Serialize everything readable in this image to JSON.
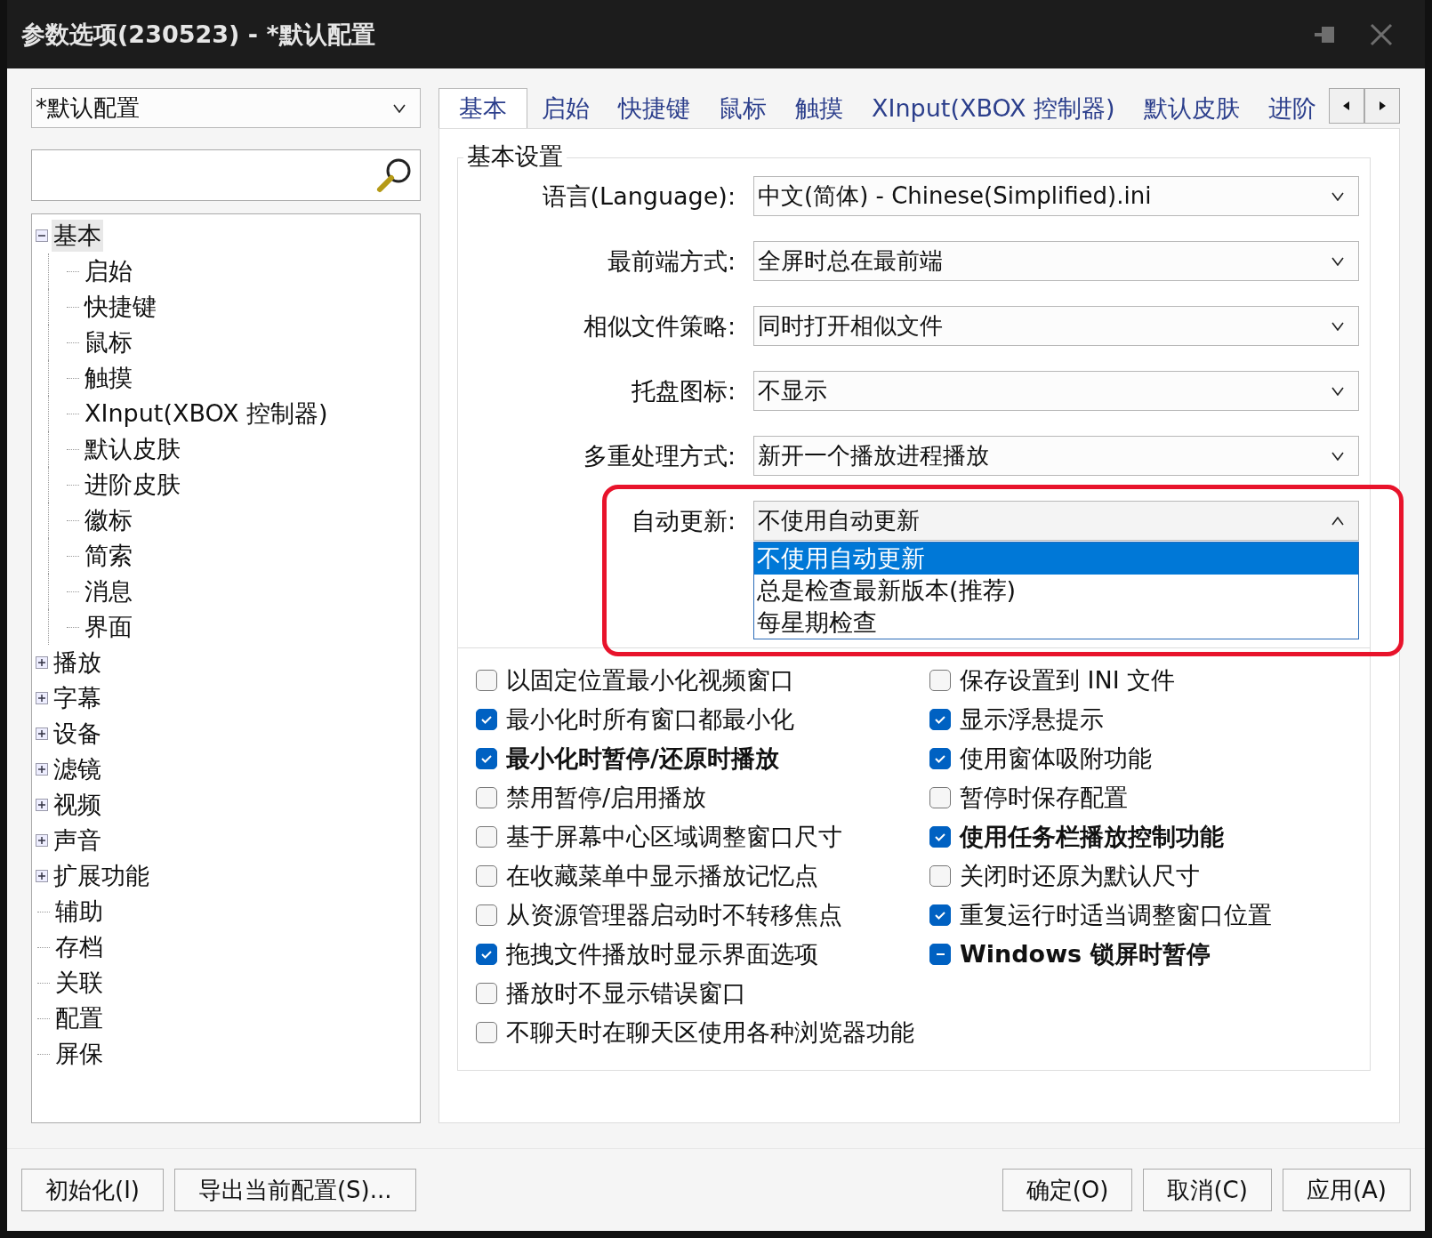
{
  "window": {
    "title": "参数选项(230523) - *默认配置"
  },
  "profile_select": {
    "value": "*默认配置"
  },
  "tree": [
    {
      "label": "基本",
      "expanded": true,
      "selected": true,
      "children": [
        {
          "label": "启始",
          "selected": false
        },
        {
          "label": "快捷键",
          "selected": false
        },
        {
          "label": "鼠标",
          "selected": false
        },
        {
          "label": "触摸",
          "selected": false
        },
        {
          "label": "XInput(XBOX 控制器)",
          "selected": false
        },
        {
          "label": "默认皮肤",
          "selected": false
        },
        {
          "label": "进阶皮肤",
          "selected": false
        },
        {
          "label": "徽标",
          "selected": false
        },
        {
          "label": "简索",
          "selected": false
        },
        {
          "label": "消息",
          "selected": false
        },
        {
          "label": "界面",
          "selected": false
        }
      ]
    },
    {
      "label": "播放",
      "expanded": false,
      "selected": false
    },
    {
      "label": "字幕",
      "expanded": false,
      "selected": false
    },
    {
      "label": "设备",
      "expanded": false,
      "selected": false
    },
    {
      "label": "滤镜",
      "expanded": false,
      "selected": false
    },
    {
      "label": "视频",
      "expanded": false,
      "selected": false
    },
    {
      "label": "声音",
      "expanded": false,
      "selected": false
    },
    {
      "label": "扩展功能",
      "expanded": false,
      "selected": false
    },
    {
      "label": "辅助",
      "selected": false
    },
    {
      "label": "存档",
      "selected": false
    },
    {
      "label": "关联",
      "selected": false
    },
    {
      "label": "配置",
      "selected": false
    },
    {
      "label": "屏保",
      "selected": false
    }
  ],
  "tabs": [
    {
      "label": "基本",
      "selected": true
    },
    {
      "label": "启始",
      "selected": false
    },
    {
      "label": "快捷键",
      "selected": false
    },
    {
      "label": "鼠标",
      "selected": false
    },
    {
      "label": "触摸",
      "selected": false
    },
    {
      "label": "XInput(XBOX 控制器)",
      "selected": false
    },
    {
      "label": "默认皮肤",
      "selected": false
    },
    {
      "label": "进阶",
      "selected": false
    }
  ],
  "settings": {
    "title": "基本设置",
    "rows": [
      {
        "label": "语言(Language):",
        "value": "中文(简体) - Chinese(Simplified).ini",
        "expanded": false,
        "highlighted": false
      },
      {
        "label": "最前端方式:",
        "value": "全屏时总在最前端",
        "expanded": false,
        "highlighted": false
      },
      {
        "label": "相似文件策略:",
        "value": "同时打开相似文件",
        "expanded": false,
        "highlighted": false
      },
      {
        "label": "托盘图标:",
        "value": "不显示",
        "expanded": false,
        "highlighted": false
      },
      {
        "label": "多重处理方式:",
        "value": "新开一个播放进程播放",
        "expanded": false,
        "highlighted": false
      },
      {
        "label": "自动更新:",
        "value": "不使用自动更新",
        "expanded": true,
        "highlighted": true,
        "options": [
          {
            "label": "不使用自动更新",
            "selected": true
          },
          {
            "label": "总是检查最新版本(推荐)",
            "selected": false
          },
          {
            "label": "每星期检查",
            "selected": false
          }
        ]
      }
    ],
    "left_checks": [
      {
        "label": "以固定位置最小化视频窗口",
        "checked": false,
        "indeterminate": false,
        "bold": false
      },
      {
        "label": "最小化时所有窗口都最小化",
        "checked": true,
        "indeterminate": false,
        "bold": false
      },
      {
        "label": "最小化时暂停/还原时播放",
        "checked": true,
        "indeterminate": false,
        "bold": true
      },
      {
        "label": "禁用暂停/启用播放",
        "checked": false,
        "indeterminate": false,
        "bold": false
      },
      {
        "label": "基于屏幕中心区域调整窗口尺寸",
        "checked": false,
        "indeterminate": false,
        "bold": false
      },
      {
        "label": "在收藏菜单中显示播放记忆点",
        "checked": false,
        "indeterminate": false,
        "bold": false
      },
      {
        "label": "从资源管理器启动时不转移焦点",
        "checked": false,
        "indeterminate": false,
        "bold": false
      },
      {
        "label": "拖拽文件播放时显示界面选项",
        "checked": true,
        "indeterminate": false,
        "bold": false
      },
      {
        "label": "播放时不显示错误窗口",
        "checked": false,
        "indeterminate": false,
        "bold": false
      },
      {
        "label": "不聊天时在聊天区使用各种浏览器功能",
        "checked": false,
        "indeterminate": false,
        "bold": false
      }
    ],
    "right_checks": [
      {
        "label": "保存设置到 INI 文件",
        "checked": false,
        "indeterminate": false,
        "bold": false
      },
      {
        "label": "显示浮悬提示",
        "checked": true,
        "indeterminate": false,
        "bold": false
      },
      {
        "label": "使用窗体吸附功能",
        "checked": true,
        "indeterminate": false,
        "bold": false
      },
      {
        "label": "暂停时保存配置",
        "checked": false,
        "indeterminate": false,
        "bold": false
      },
      {
        "label": "使用任务栏播放控制功能",
        "checked": true,
        "indeterminate": false,
        "bold": true
      },
      {
        "label": "关闭时还原为默认尺寸",
        "checked": false,
        "indeterminate": false,
        "bold": false
      },
      {
        "label": "重复运行时适当调整窗口位置",
        "checked": true,
        "indeterminate": false,
        "bold": false
      },
      {
        "label": "Windows 锁屏时暂停",
        "checked": true,
        "indeterminate": true,
        "bold": true
      }
    ]
  },
  "left_buttons": [
    "初始化(I)",
    "导出当前配置(S)..."
  ],
  "right_buttons": [
    "确定(O)",
    "取消(C)",
    "应用(A)"
  ]
}
